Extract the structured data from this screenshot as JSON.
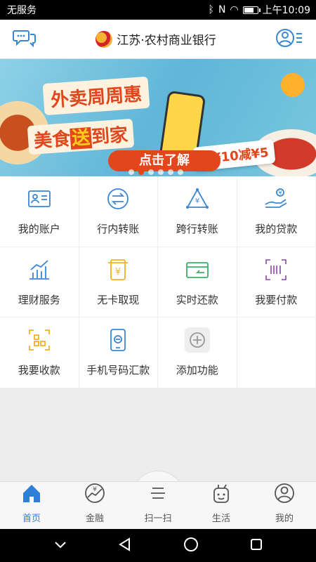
{
  "status_bar": {
    "carrier": "无服务",
    "time": "上午10:09",
    "battery_level": 0.8
  },
  "header": {
    "chat_icon": "chat-bubbles-icon",
    "bank_name": "江苏·农村商业银行",
    "user_icon": "user-menu-icon"
  },
  "banner": {
    "line1": "外卖周周惠",
    "line2_a": "美食",
    "line2_b": "送",
    "line2_c": "到家",
    "promo": "满¥10减¥5",
    "cta": "点击了解",
    "dot_count": 6,
    "active_dot": 1
  },
  "grid": [
    {
      "label": "我的账户",
      "icon": "id-card-icon",
      "color": "#3a86d6"
    },
    {
      "label": "行内转账",
      "icon": "exchange-icon",
      "color": "#3a86d6"
    },
    {
      "label": "跨行转账",
      "icon": "triangle-yen-icon",
      "color": "#3a86d6"
    },
    {
      "label": "我的贷款",
      "icon": "hand-coins-icon",
      "color": "#3a86d6"
    },
    {
      "label": "理财服务",
      "icon": "bar-chart-icon",
      "color": "#3a86d6"
    },
    {
      "label": "无卡取现",
      "icon": "yen-ticket-icon",
      "color": "#f0b323"
    },
    {
      "label": "实时还款",
      "icon": "card-return-icon",
      "color": "#3ab06a"
    },
    {
      "label": "我要付款",
      "icon": "barcode-scan-icon",
      "color": "#9b59b6"
    },
    {
      "label": "我要收款",
      "icon": "qr-frame-icon",
      "color": "#f0b323"
    },
    {
      "label": "手机号码汇款",
      "icon": "phone-transfer-icon",
      "color": "#3a86d6"
    },
    {
      "label": "添加功能",
      "icon": "add-icon",
      "color": "#999999"
    },
    {
      "label": "",
      "icon": "",
      "color": ""
    }
  ],
  "tabs": [
    {
      "label": "首页",
      "icon": "home-icon",
      "active": true
    },
    {
      "label": "金融",
      "icon": "finance-icon",
      "active": false
    },
    {
      "label": "扫一扫",
      "icon": "scan-icon",
      "active": false
    },
    {
      "label": "生活",
      "icon": "life-icon",
      "active": false
    },
    {
      "label": "我的",
      "icon": "profile-icon",
      "active": false
    }
  ],
  "colors": {
    "accent": "#2d7fd8",
    "banner_red": "#e2461c"
  }
}
